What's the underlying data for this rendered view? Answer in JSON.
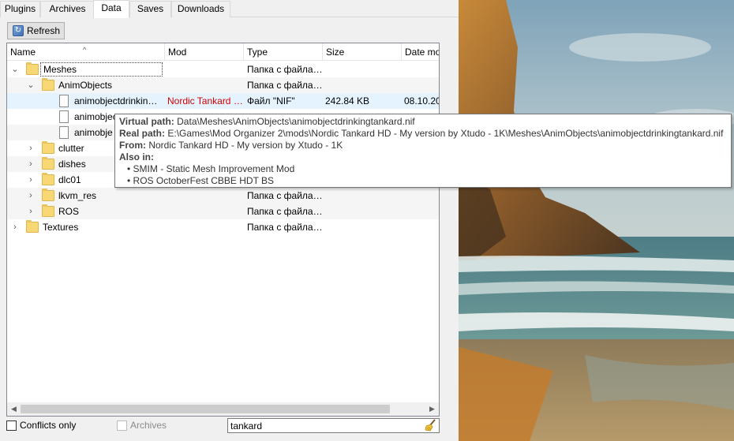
{
  "tabs": [
    {
      "label": "Plugins"
    },
    {
      "label": "Archives"
    },
    {
      "label": "Data"
    },
    {
      "label": "Saves"
    },
    {
      "label": "Downloads"
    }
  ],
  "toolbar": {
    "refresh_label": "Refresh"
  },
  "columns": [
    "Name",
    "Mod",
    "Type",
    "Size",
    "Date mo"
  ],
  "rows": [
    {
      "name": "Meshes",
      "mod": "",
      "type": "Папка с файла…",
      "size": "",
      "date": ""
    },
    {
      "name": "AnimObjects",
      "mod": "",
      "type": "Папка с файла…",
      "size": "",
      "date": ""
    },
    {
      "name": "animobjectdrinkin…",
      "mod": "Nordic Tankard …",
      "type": "Файл \"NIF\"",
      "size": "242.84 KB",
      "date": "08.10.20"
    },
    {
      "name": "animobject",
      "mod": "",
      "type": "",
      "size": "",
      "date": ""
    },
    {
      "name": "animobje",
      "mod": "",
      "type": "",
      "size": "",
      "date": ""
    },
    {
      "name": "clutter",
      "mod": "",
      "type": "",
      "size": "",
      "date": ""
    },
    {
      "name": "dishes",
      "mod": "",
      "type": "",
      "size": "",
      "date": ""
    },
    {
      "name": "dlc01",
      "mod": "",
      "type": "",
      "size": "",
      "date": ""
    },
    {
      "name": "lkvm_res",
      "mod": "",
      "type": "Папка с файла…",
      "size": "",
      "date": ""
    },
    {
      "name": "ROS",
      "mod": "",
      "type": "Папка с файла…",
      "size": "",
      "date": ""
    },
    {
      "name": "Textures",
      "mod": "",
      "type": "Папка с файла…",
      "size": "",
      "date": ""
    }
  ],
  "tooltip": {
    "virtual_label": "Virtual path:",
    "virtual_value": "Data\\Meshes\\AnimObjects\\animobjectdrinkingtankard.nif",
    "real_label": "Real path:",
    "real_value": "E:\\Games\\Mod Organizer 2\\mods\\Nordic Tankard HD - My version by Xtudo - 1K\\Meshes\\AnimObjects\\animobjectdrinkingtankard.nif",
    "from_label": "From:",
    "from_value": "Nordic Tankard HD - My version by Xtudo - 1K",
    "also_label": "Also in:",
    "also_items": [
      "SMIM - Static Mesh Improvement Mod",
      "ROS OctoberFest CBBE HDT BS"
    ]
  },
  "bottom": {
    "conflicts_label": "Conflicts only",
    "archives_label": "Archives",
    "filter_value": "tankard"
  },
  "colors": {
    "conflict": "#d40000",
    "hover_row": "#e5f3ff",
    "folder": "#f8d775"
  }
}
